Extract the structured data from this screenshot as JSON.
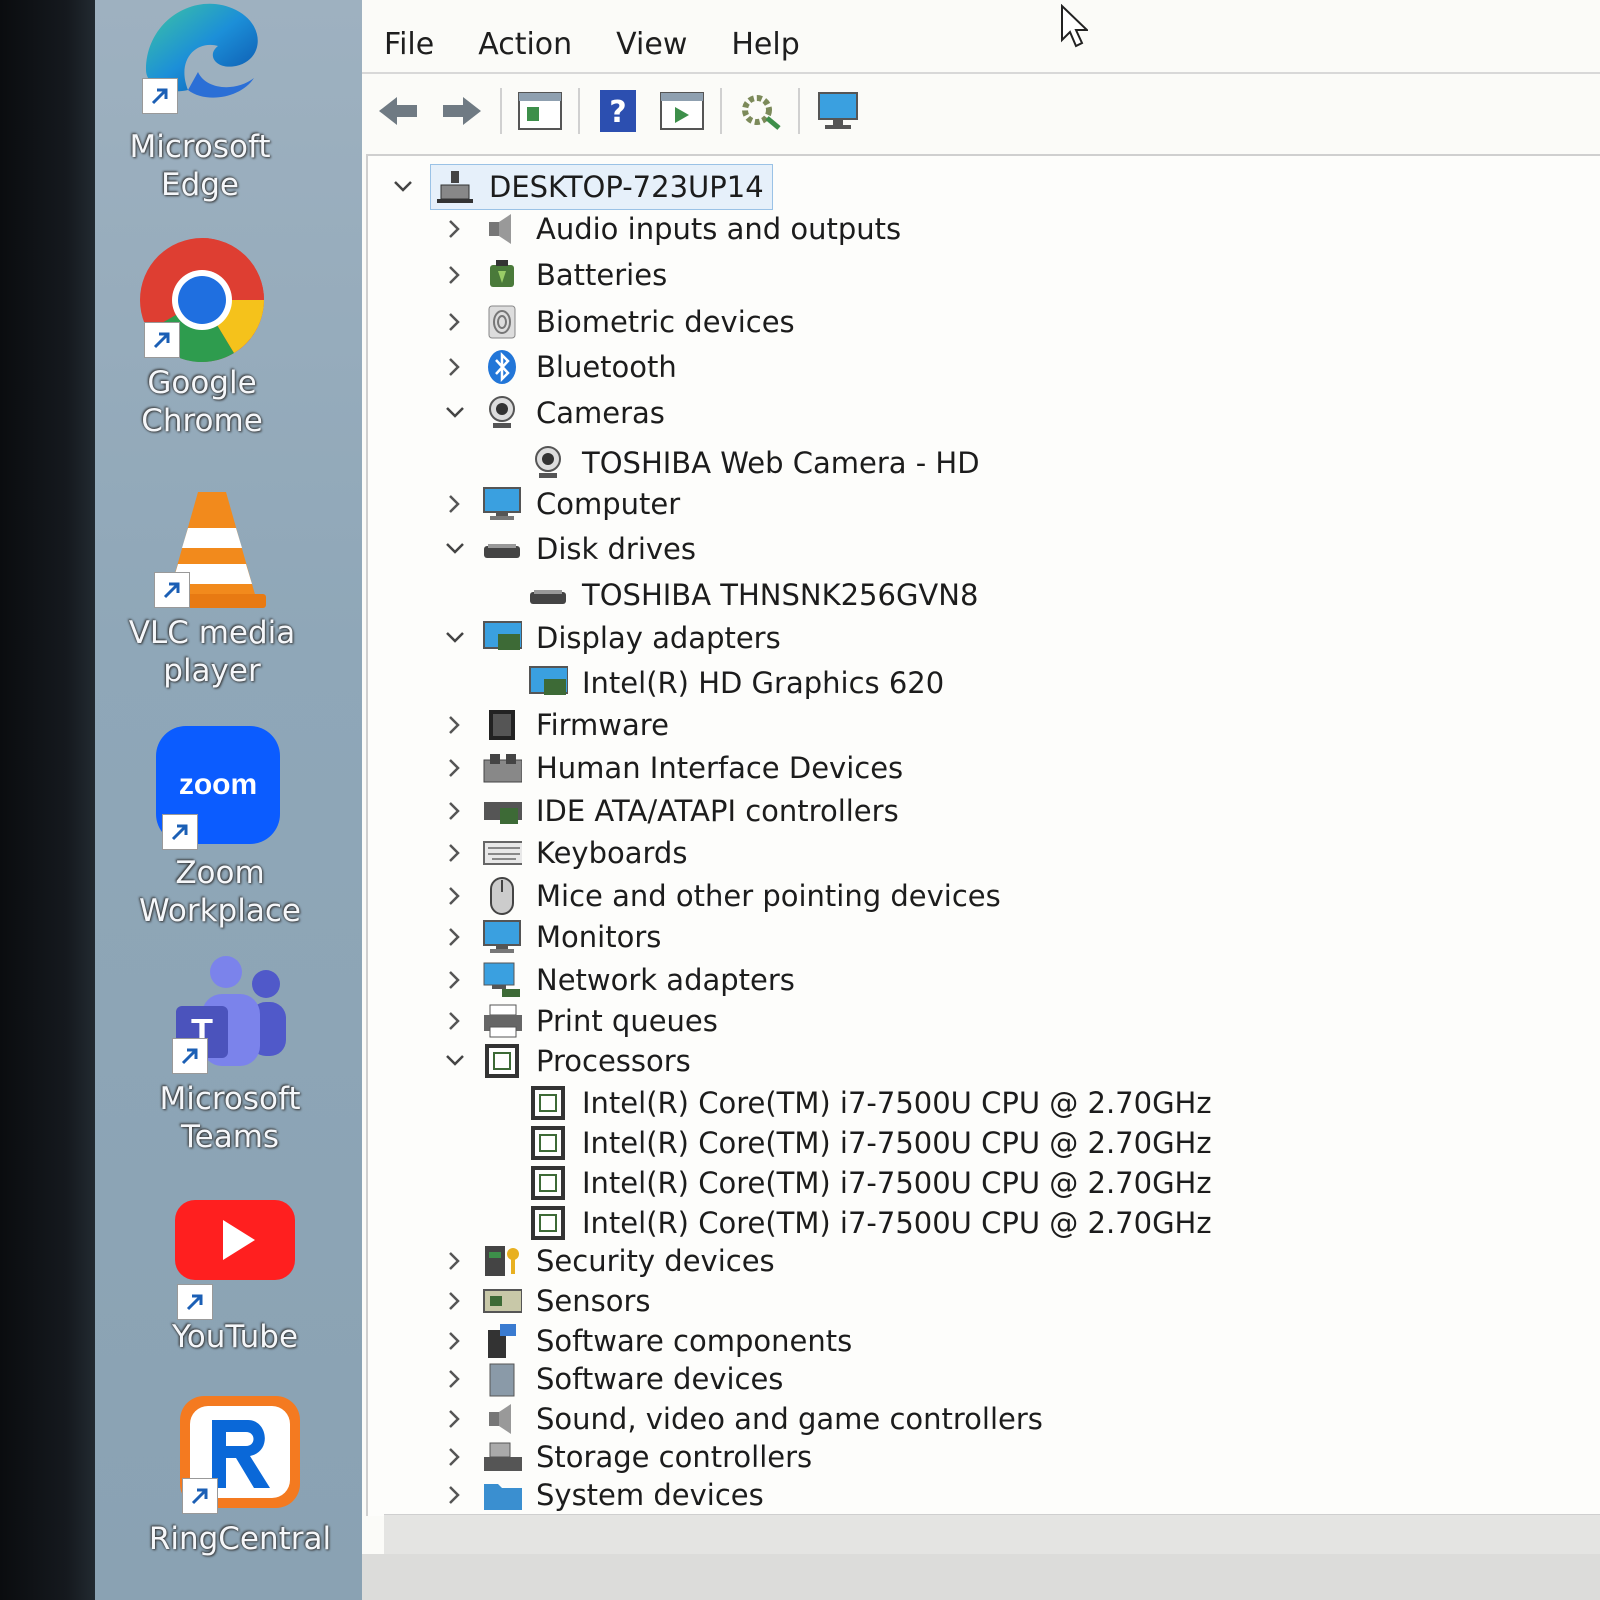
{
  "desktop": {
    "icons": [
      {
        "line1": "Microsoft",
        "line2": "Edge"
      },
      {
        "line1": "Google",
        "line2": "Chrome"
      },
      {
        "line1": "VLC media",
        "line2": "player"
      },
      {
        "line1": "Zoom",
        "line2": "Workplace",
        "logo_text": "zoom"
      },
      {
        "line1": "Microsoft",
        "line2": "Teams"
      },
      {
        "line1": "",
        "line2": "YouTube"
      },
      {
        "line1": "",
        "line2": "RingCentral"
      }
    ]
  },
  "menu": [
    "File",
    "Action",
    "View",
    "Help"
  ],
  "toolbar": [
    "back-icon",
    "forward-icon",
    "properties-icon",
    "help-icon",
    "update-driver-icon",
    "scan-hardware-icon",
    "monitor-icon"
  ],
  "tree": {
    "root": "DESKTOP-723UP14",
    "items": [
      {
        "label": "Audio inputs and outputs",
        "expanded": false,
        "icon": "speaker"
      },
      {
        "label": "Batteries",
        "expanded": false,
        "icon": "battery"
      },
      {
        "label": "Biometric devices",
        "expanded": false,
        "icon": "fingerprint"
      },
      {
        "label": "Bluetooth",
        "expanded": false,
        "icon": "bluetooth"
      },
      {
        "label": "Cameras",
        "expanded": true,
        "icon": "camera"
      },
      {
        "label": "TOSHIBA Web Camera - HD",
        "child": true,
        "icon": "camera"
      },
      {
        "label": "Computer",
        "expanded": false,
        "icon": "monitor"
      },
      {
        "label": "Disk drives",
        "expanded": true,
        "icon": "disk"
      },
      {
        "label": "TOSHIBA THNSNK256GVN8",
        "child": true,
        "icon": "disk"
      },
      {
        "label": "Display adapters",
        "expanded": true,
        "icon": "display"
      },
      {
        "label": "Intel(R) HD Graphics 620",
        "child": true,
        "icon": "display"
      },
      {
        "label": "Firmware",
        "expanded": false,
        "icon": "chip"
      },
      {
        "label": "Human Interface Devices",
        "expanded": false,
        "icon": "hid"
      },
      {
        "label": "IDE ATA/ATAPI controllers",
        "expanded": false,
        "icon": "ide"
      },
      {
        "label": "Keyboards",
        "expanded": false,
        "icon": "keyboard"
      },
      {
        "label": "Mice and other pointing devices",
        "expanded": false,
        "icon": "mouse"
      },
      {
        "label": "Monitors",
        "expanded": false,
        "icon": "monitor"
      },
      {
        "label": "Network adapters",
        "expanded": false,
        "icon": "network"
      },
      {
        "label": "Print queues",
        "expanded": false,
        "icon": "printer"
      },
      {
        "label": "Processors",
        "expanded": true,
        "icon": "cpu"
      },
      {
        "label": "Intel(R) Core(TM) i7-7500U CPU @ 2.70GHz",
        "child": true,
        "icon": "cpu"
      },
      {
        "label": "Intel(R) Core(TM) i7-7500U CPU @ 2.70GHz",
        "child": true,
        "icon": "cpu"
      },
      {
        "label": "Intel(R) Core(TM) i7-7500U CPU @ 2.70GHz",
        "child": true,
        "icon": "cpu"
      },
      {
        "label": "Intel(R) Core(TM) i7-7500U CPU @ 2.70GHz",
        "child": true,
        "icon": "cpu"
      },
      {
        "label": "Security devices",
        "expanded": false,
        "icon": "security"
      },
      {
        "label": "Sensors",
        "expanded": false,
        "icon": "sensor"
      },
      {
        "label": "Software components",
        "expanded": false,
        "icon": "component"
      },
      {
        "label": "Software devices",
        "expanded": false,
        "icon": "softdev"
      },
      {
        "label": "Sound, video and game controllers",
        "expanded": false,
        "icon": "speaker"
      },
      {
        "label": "Storage controllers",
        "expanded": false,
        "icon": "storage"
      },
      {
        "label": "System devices",
        "expanded": false,
        "icon": "folder"
      }
    ]
  },
  "colors": {
    "accent": "#2f7fd3",
    "selection": "#e6f0fa",
    "desktop": "#8fa7b8"
  }
}
